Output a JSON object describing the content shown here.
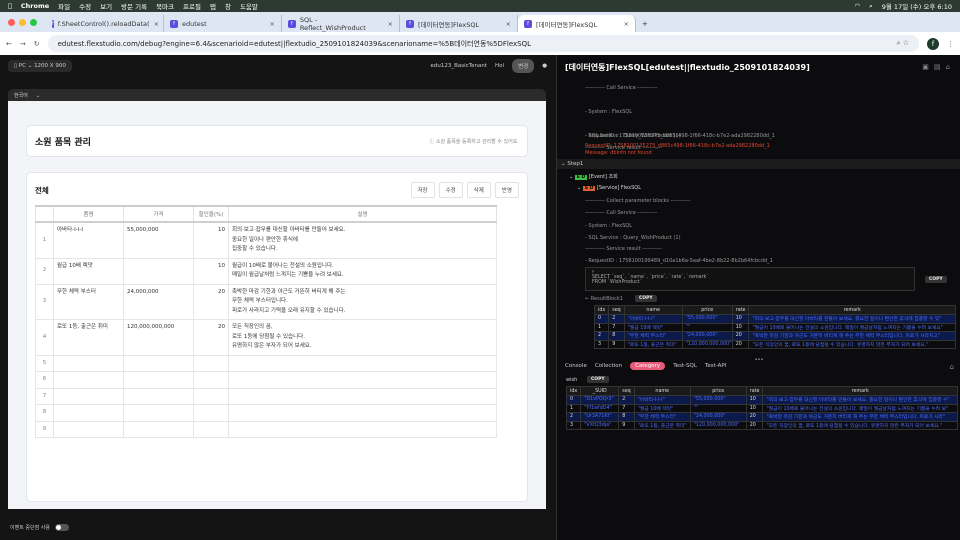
{
  "menubar": {
    "app": "Chrome",
    "items": [
      "파일",
      "수정",
      "보기",
      "방문 기록",
      "북마크",
      "프로필",
      "탭",
      "창",
      "도움말"
    ],
    "clock": "9월 17일 (수) 오후 6:10"
  },
  "tabs": [
    {
      "label": "f.SheetControl().reloadData("
    },
    {
      "label": "edutest"
    },
    {
      "label": "SQL - Reflect_WishProduct"
    },
    {
      "label": "[데이터연동]FlexSQL"
    },
    {
      "label": "[데이터연동]FlexSQL",
      "active": true
    }
  ],
  "address": {
    "url": "edutest.flexstudio.com/debug?engine=6.4&scenarioid=edutest||flextudio_2509101824039&scenarioname=%5B데이터연동%5DFlexSQL",
    "avatar": "f"
  },
  "preview": {
    "device": "PC",
    "resolution": "1200 X 900",
    "tenant": "edu123_BasicTenant",
    "user": "Hol",
    "change_label": "변경",
    "language": "한국어",
    "toggle_label": "이벤트 중단점 사용"
  },
  "page": {
    "title": "소원 품목 관리",
    "hint": "소원 품목을 등록하고 관리할 수 있어요.",
    "section": "전체",
    "buttons": [
      "저장",
      "수정",
      "삭제",
      "반영"
    ],
    "columns": [
      "품명",
      "가격",
      "할인율(%)",
      "설명"
    ],
    "rows": [
      {
        "no": "1",
        "name": "아바타-I-I-I",
        "price": "55,000,000",
        "rate": "10",
        "desc": [
          "회의·보고·잡무를 대신할 아바타를 만들어 보세요.",
          "중요한 일이나 편안한 휴식에",
          "집중할 수 있습니다."
        ]
      },
      {
        "no": "2",
        "name": "월급 10배 렉맛",
        "price": "",
        "rate": "10",
        "desc": [
          "월급이 10배로 불어나는 전설의 소원입니다.",
          "매일이 월급날처럼 느껴지는 기쁨을 누려 보세요."
        ]
      },
      {
        "no": "3",
        "name": "무한 체력 부스터",
        "price": "24,000,000",
        "rate": "20",
        "desc": [
          "촉박한 마감 기한과 야근도 거뜬히 버티게 해 주는",
          "무한 체력 부스터입니다.",
          "피로가 사라지고 기력을 오래 유지할 수 있습니다."
        ]
      },
      {
        "no": "4",
        "name": "로또 1등, 출근은 취미",
        "price": "120,000,000,000",
        "rate": "20",
        "desc": [
          "모든 직장인의 꿈,",
          "로또 1등에 당첨될 수 있습니다.",
          "유명하지 않은 부자가 되어 보세요."
        ]
      }
    ],
    "empty_rows": [
      "5",
      "6",
      "7",
      "8",
      "9"
    ]
  },
  "debug": {
    "title": "[데이터연동]FlexSQL[edutest||flextudio_2509101824039]",
    "log1": [
      "----------- Call Service -----------",
      "- System : FlexSQL",
      "- SQL Service : Query_WishProduct (1)",
      "----------- Service result -----------",
      "- RequestID : 1758100135275_d865c498-1f66-418c-b7e2-ada2982280dd_1"
    ],
    "error": [
      "RequestID: 1758100135275_d865c498-1f66-418c-b7e2-ada2982280dd_1",
      "Message: dbInfo not found"
    ],
    "step": "Step1",
    "event": "[Event] 조회",
    "service": "[Service] FlexSQL",
    "log2": [
      "----------- Collect parameter blocks -----------",
      "----------- Call Service -----------",
      "- System : FlexSQL",
      "- SQL Service : Query_WishProduct (1)",
      "----------- Service result -----------",
      "- RequestID : 1758100199489_d10a1b6a-5aaf-4be2-8b22-8b2b64fcbcdd_1"
    ],
    "sql": [
      "SELECT `seq`, `name`, `price`, `rate`, `remark`",
      "FROM `WishProduct`"
    ],
    "copy": "COPY",
    "result_label": "ResultBlock1",
    "result_cols": [
      "idx",
      "seq",
      "name",
      "price",
      "rate",
      "remark"
    ],
    "result_rows": [
      [
        "0",
        "2",
        "\"아바타-I-I-I\"",
        "\"55,000,000\"",
        "10",
        "\"회의·보고·잡무를 대신할 아바타를 만들어 보세요. 중요한 일이나 편안한 휴식에 집중할 수 있\""
      ],
      [
        "1",
        "7",
        "\"월급 10배 렉맛\"",
        "\"\"",
        "10",
        "\"월급이 10배로 불어나는 전설의 소원입니다. 매일이 월급날처럼 느껴지는 기쁨을 누려 보세요\""
      ],
      [
        "2",
        "8",
        "\"무한 체력 부스터\"",
        "\"24,000,000\"",
        "20",
        "\"촉박한 마감 기한과 야근도 거뜬히 버티게 해 주는 무한 체력 부스터입니다. 피로가 사라지고\""
      ],
      [
        "3",
        "9",
        "\"로또 1등, 출근은 취미\"",
        "\"120,000,000,000\"",
        "20",
        "\"모든 직장인의 꿈, 로또 1등에 당첨될 수 있습니다. 유명하지 않은 부자가 되어 보세요.\""
      ]
    ],
    "console_tabs": [
      "Console",
      "Collection",
      "Category",
      "Test-SQL",
      "Test-API"
    ],
    "active_console_tab": "Category",
    "collection_name": "wish",
    "coll_cols": [
      "idx",
      "_SUID",
      "seq",
      "name",
      "price",
      "rate",
      "remark"
    ],
    "coll_rows": [
      [
        "0",
        "\"D1vPOQr3\"",
        "2",
        "\"아바타-I-I-I\"",
        "\"55,000,000\"",
        "10",
        "\"회의·보고·잡무를 대신할 아바타를 만들어 보세요. 중요한 일이나 편안한 휴식에 집중할 수\""
      ],
      [
        "1",
        "\"Yf1wfdO4\"",
        "7",
        "\"월급 10배 렉맛\"",
        "\"\"",
        "10",
        "\"월급이 10배로 불어나는 전설의 소원입니다. 매일이 월급날처럼 느껴지는 기쁨을 누려 보\""
      ],
      [
        "2",
        "\"Ur3A71Kt\"",
        "8",
        "\"무한 체력 부스터\"",
        "\"24,000,000\"",
        "20",
        "\"촉박한 마감 기한과 야근도 거뜬히 버티게 해 주는 무한 체력 부스터입니다. 피로가 사라\""
      ],
      [
        "3",
        "\"VXtQ3dja\"",
        "9",
        "\"로또 1등, 출근은 취미\"",
        "\"120,000,000,000\"",
        "20",
        "\"모든 직장인의 꿈, 로또 1등에 당첨될 수 있습니다. 유명하지 않은 부자가 되어 보세요.\""
      ]
    ]
  },
  "colors": {
    "accent": "#e85a7a",
    "error": "#e0472d",
    "link": "#4d6cff"
  }
}
